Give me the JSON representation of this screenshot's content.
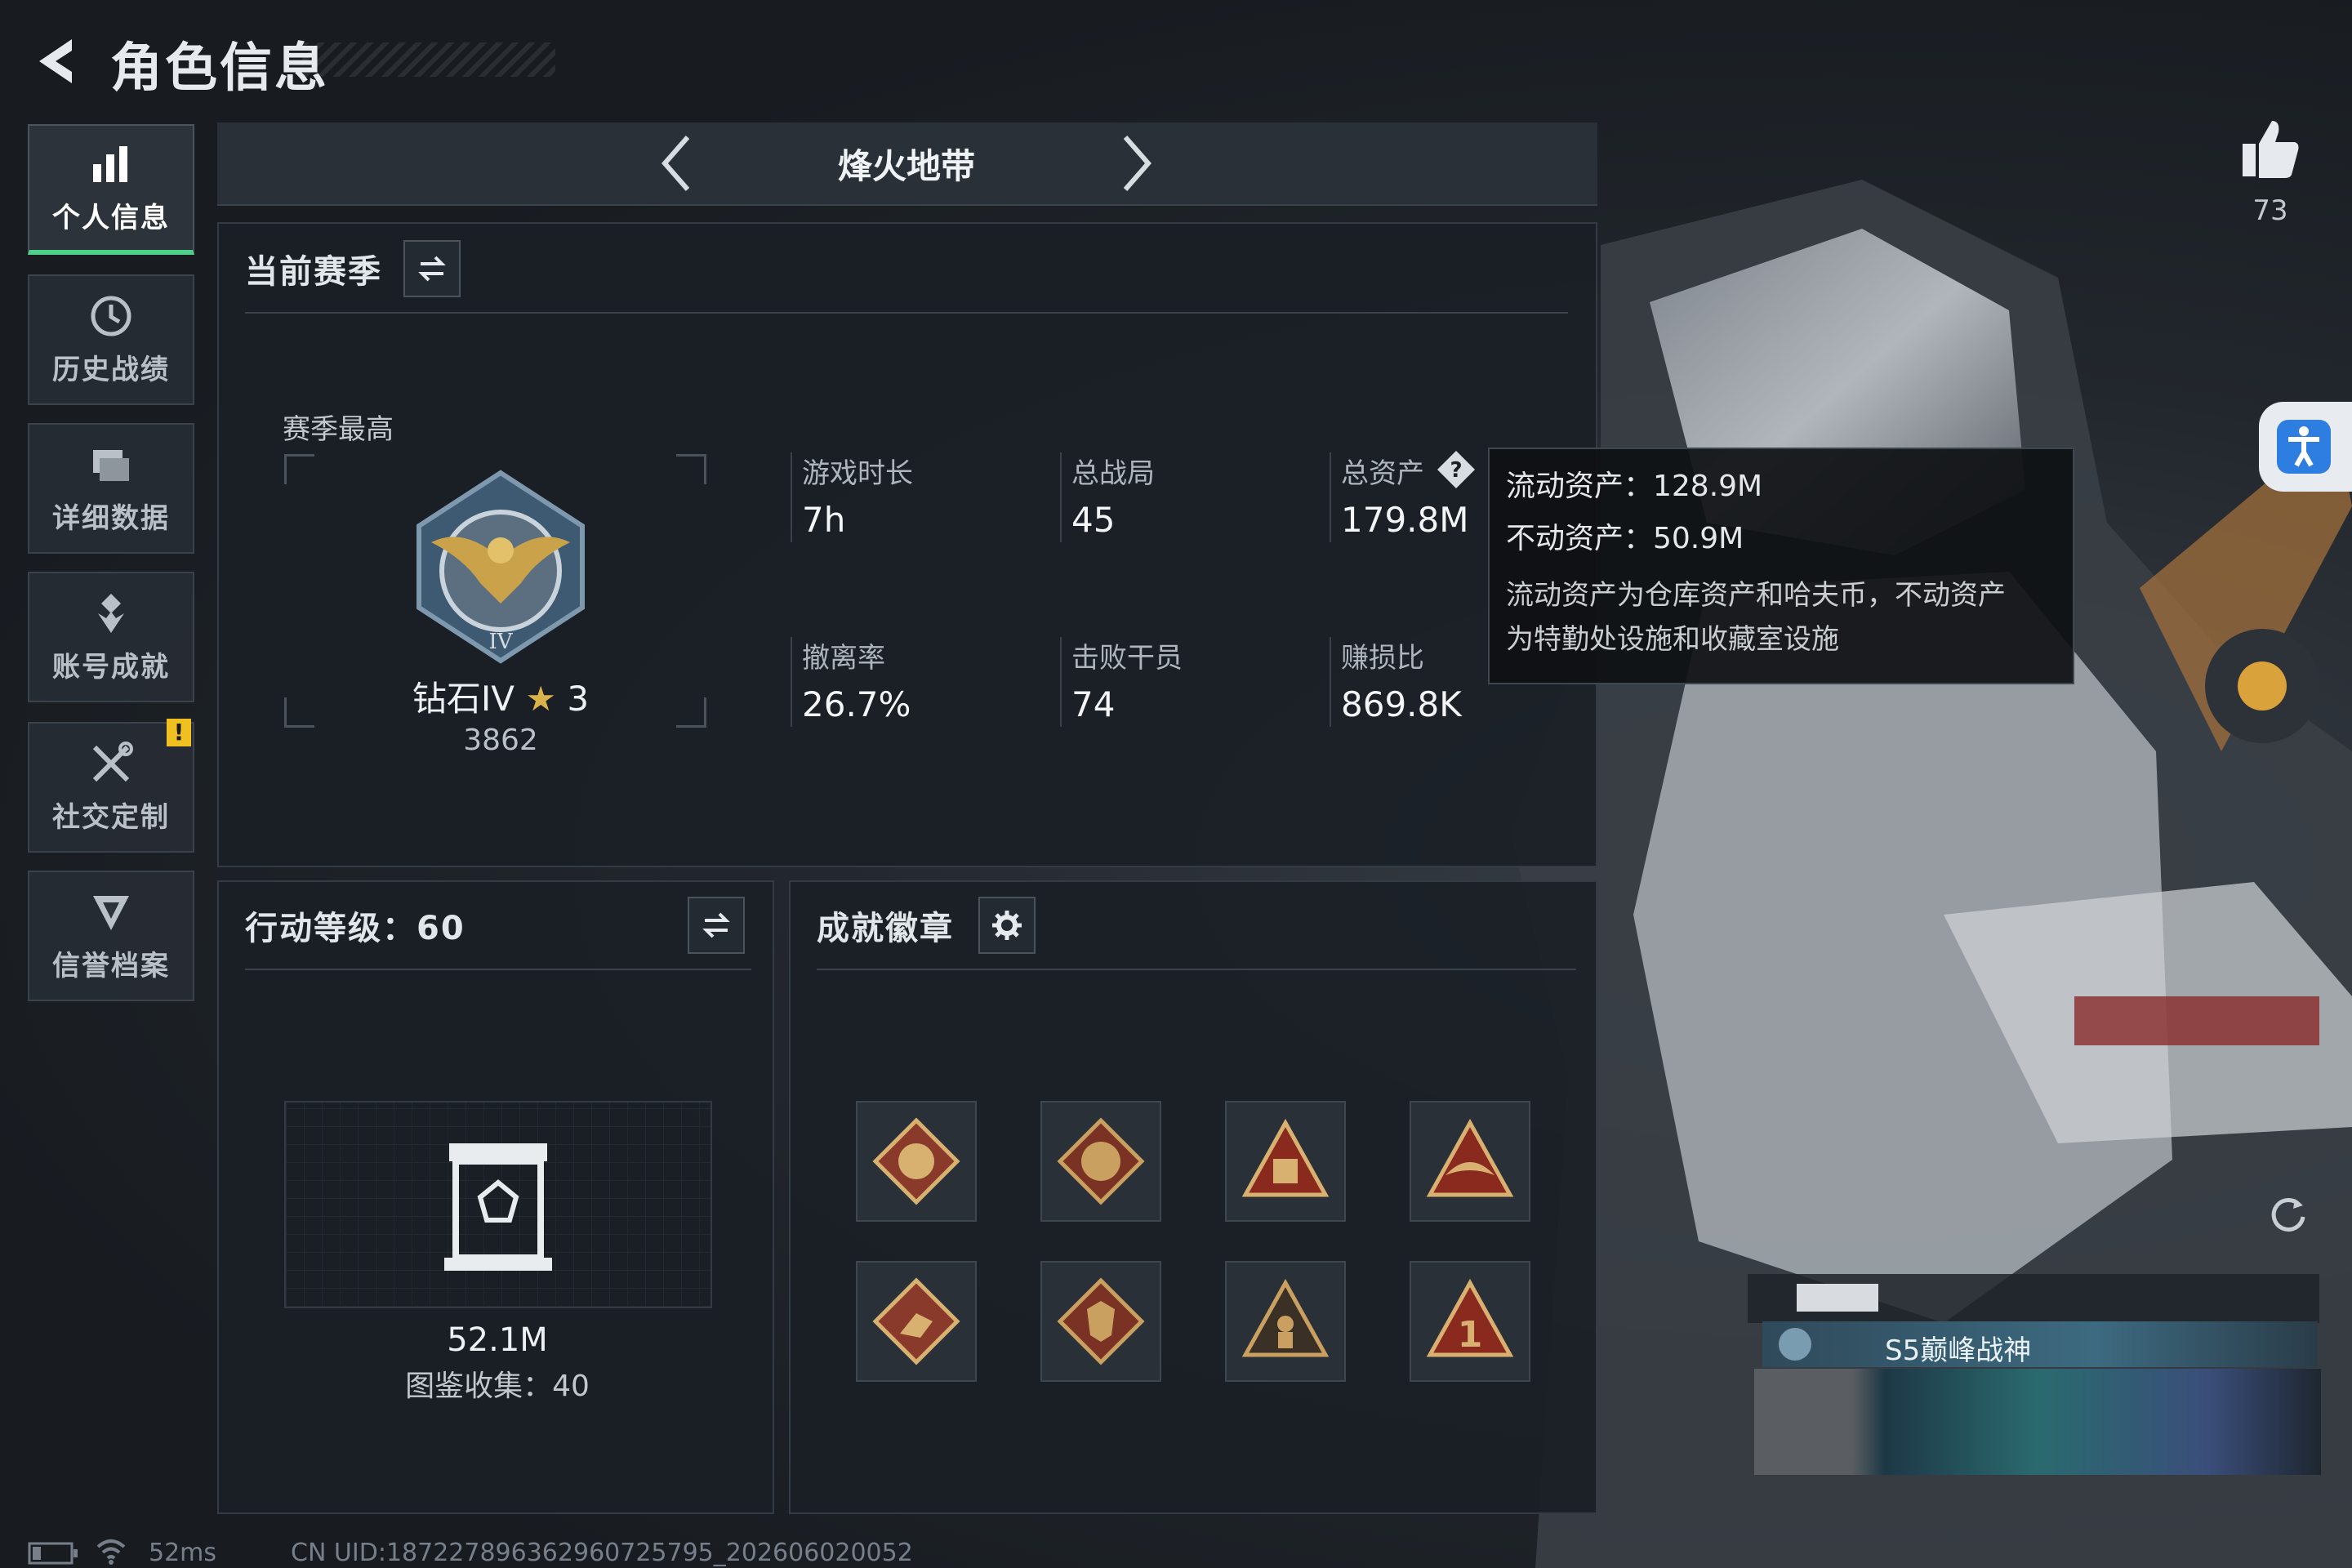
{
  "header": {
    "title": "角色信息"
  },
  "sidebar": {
    "items": [
      {
        "label": "个人信息"
      },
      {
        "label": "历史战绩"
      },
      {
        "label": "详细数据"
      },
      {
        "label": "账号成就"
      },
      {
        "label": "社交定制"
      },
      {
        "label": "信誉档案"
      }
    ],
    "warn_badge": "!"
  },
  "mode": {
    "title": "烽火地带"
  },
  "season": {
    "title": "当前赛季",
    "best_label": "赛季最高",
    "rank_name": "钻石IV",
    "rank_stars": "3",
    "rank_score": "3862",
    "stats": [
      {
        "label": "游戏时长",
        "value": "7h"
      },
      {
        "label": "总战局",
        "value": "45"
      },
      {
        "label": "总资产",
        "value": "179.8M"
      },
      {
        "label": "撤离率",
        "value": "26.7%"
      },
      {
        "label": "击败干员",
        "value": "74"
      },
      {
        "label": "赚损比",
        "value": "869.8K"
      }
    ]
  },
  "tooltip": {
    "liquid": "流动资产：128.9M",
    "fixed": "不动资产：50.9M",
    "desc1": "流动资产为仓库资产和哈夫币，不动资产",
    "desc2": "为特勤处设施和收藏室设施"
  },
  "action_level": {
    "title": "行动等级：60",
    "value": "52.1M",
    "collection": "图鉴收集：40"
  },
  "achievements": {
    "title": "成就徽章"
  },
  "likes": {
    "count": "73"
  },
  "player_card": {
    "title": "S5巅峰战神"
  },
  "footer": {
    "ping": "52ms",
    "uid": "CN UID:18722789636296072579​5_202606020052"
  }
}
